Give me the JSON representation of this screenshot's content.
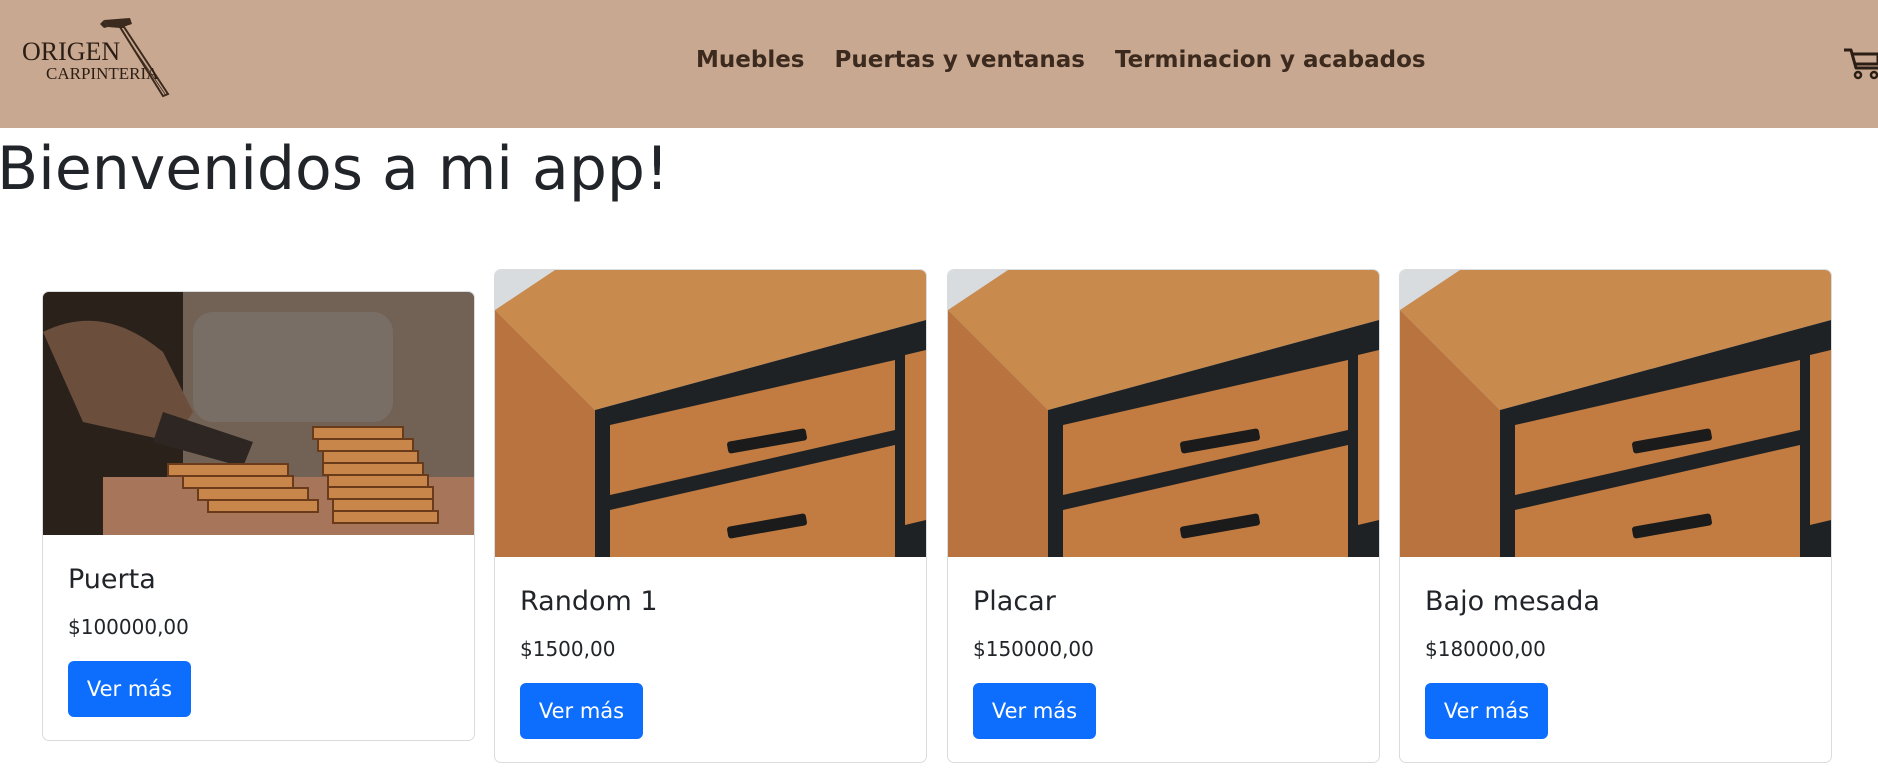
{
  "brand": {
    "name_line1": "ORIGEN",
    "name_line2": "CARPINTERIA",
    "icon": "hammer-icon"
  },
  "nav": {
    "items": [
      {
        "label": "Muebles"
      },
      {
        "label": "Puertas y ventanas"
      },
      {
        "label": "Terminacion y acabados"
      }
    ],
    "cart_icon": "cart-icon"
  },
  "main": {
    "title": "Bienvenidos a mi app!"
  },
  "products": [
    {
      "name": "Puerta",
      "price": "$100000,00",
      "button_label": "Ver más",
      "image": "wood-planks-photo"
    },
    {
      "name": "Random 1",
      "price": "$1500,00",
      "button_label": "Ver más",
      "image": "wooden-dresser-photo"
    },
    {
      "name": "Placar",
      "price": "$150000,00",
      "button_label": "Ver más",
      "image": "wooden-dresser-photo"
    },
    {
      "name": "Bajo mesada",
      "price": "$180000,00",
      "button_label": "Ver más",
      "image": "wooden-dresser-photo"
    }
  ],
  "colors": {
    "navbar_bg": "#c9a891",
    "nav_text": "#3b2a1d",
    "button_bg": "#0d6efd",
    "button_text": "#ffffff"
  }
}
